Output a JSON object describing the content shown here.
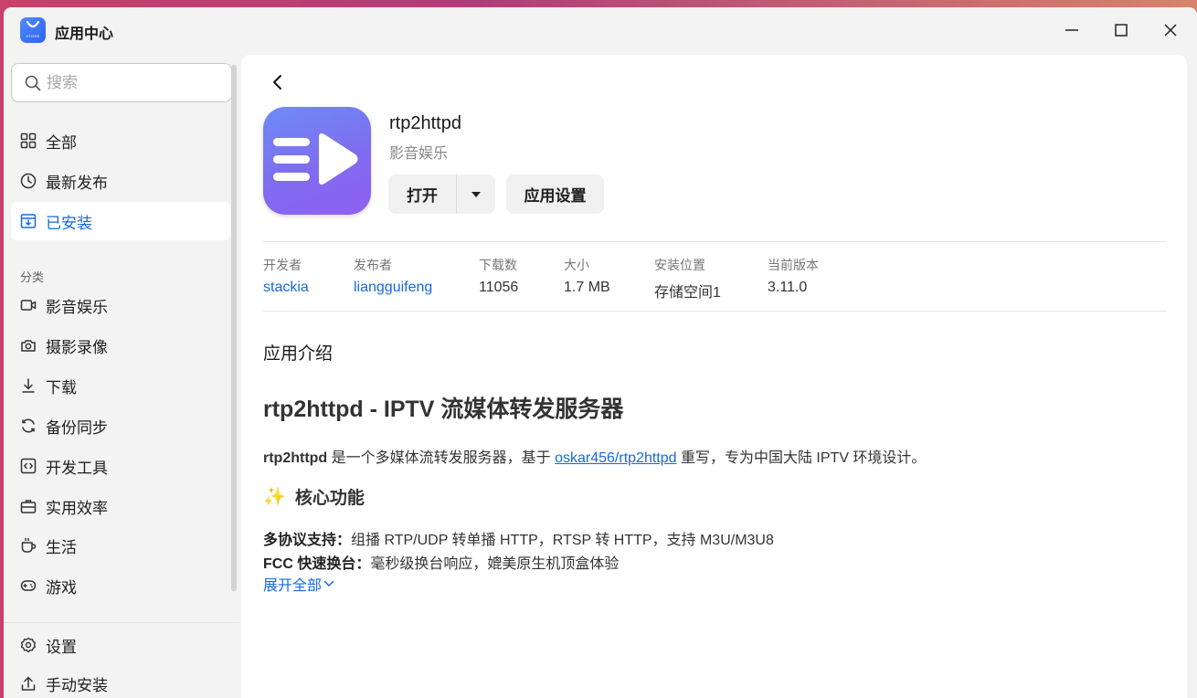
{
  "window": {
    "title": "应用中心",
    "logo_text": "STORE"
  },
  "sidebar": {
    "search_placeholder": "搜索",
    "top_items": [
      {
        "label": "全部",
        "icon": "grid-icon"
      },
      {
        "label": "最新发布",
        "icon": "clock-icon"
      },
      {
        "label": "已安装",
        "icon": "installed-icon",
        "active": true
      }
    ],
    "section_label": "分类",
    "categories": [
      {
        "label": "影音娱乐",
        "icon": "video-icon"
      },
      {
        "label": "摄影录像",
        "icon": "camera-icon"
      },
      {
        "label": "下载",
        "icon": "download-icon"
      },
      {
        "label": "备份同步",
        "icon": "sync-icon"
      },
      {
        "label": "开发工具",
        "icon": "code-icon"
      },
      {
        "label": "实用效率",
        "icon": "briefcase-icon"
      },
      {
        "label": "生活",
        "icon": "cup-icon"
      },
      {
        "label": "游戏",
        "icon": "gamepad-icon"
      }
    ],
    "bottom_items": [
      {
        "label": "设置",
        "icon": "gear-icon"
      },
      {
        "label": "手动安装",
        "icon": "upload-icon"
      }
    ]
  },
  "app": {
    "name": "rtp2httpd",
    "category": "影音娱乐",
    "open_label": "打开",
    "settings_label": "应用设置",
    "meta": [
      {
        "label": "开发者",
        "value": "stackia",
        "link": true
      },
      {
        "label": "发布者",
        "value": "liangguifeng",
        "link": true
      },
      {
        "label": "下载数",
        "value": "11056",
        "link": false
      },
      {
        "label": "大小",
        "value": "1.7 MB",
        "link": false
      },
      {
        "label": "安装位置",
        "value": "存储空间1",
        "link": false
      },
      {
        "label": "当前版本",
        "value": "3.11.0",
        "link": false
      }
    ]
  },
  "intro": {
    "label": "应用介绍",
    "heading": "rtp2httpd - IPTV 流媒体转发服务器",
    "para_bold": "rtp2httpd",
    "para_text1": " 是一个多媒体流转发服务器，基于 ",
    "para_link": "oskar456/rtp2httpd",
    "para_text2": " 重写，专为中国大陆 IPTV 环境设计。",
    "features_heading": "核心功能",
    "features_emoji": "✨",
    "features": [
      {
        "title": "多协议支持：",
        "text": "组播 RTP/UDP 转单播 HTTP，RTSP 转 HTTP，支持 M3U/M3U8"
      },
      {
        "title": "FCC 快速换台：",
        "text": "毫秒级换台响应，媲美原生机顶盒体验"
      }
    ],
    "expand_label": "展开全部"
  }
}
